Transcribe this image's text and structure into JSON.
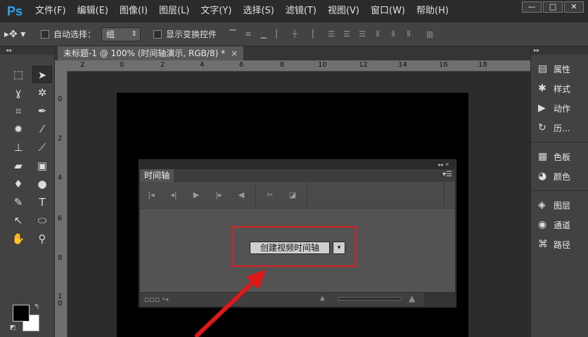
{
  "app": {
    "logo": "Ps"
  },
  "menu": [
    "文件(F)",
    "编辑(E)",
    "图像(I)",
    "图层(L)",
    "文字(Y)",
    "选择(S)",
    "滤镜(T)",
    "视图(V)",
    "窗口(W)",
    "帮助(H)"
  ],
  "window_controls": {
    "minimize": "—",
    "restore": "□",
    "close": "✕"
  },
  "options_bar": {
    "auto_select_label": "自动选择：",
    "auto_select_value": "组",
    "show_transform_label": "显示变换控件"
  },
  "document": {
    "tab_title": "未标题-1 @ 100% (时间轴演示, RGB/8) *",
    "close": "×"
  },
  "ruler": {
    "top_labels": [
      "2",
      "0",
      "2",
      "4",
      "6",
      "8",
      "10",
      "12",
      "14",
      "16",
      "18"
    ],
    "left_labels": [
      "0",
      "2",
      "4",
      "6",
      "8",
      "1 0"
    ]
  },
  "timeline": {
    "tab_label": "时间轴",
    "create_button_label": "创建视频时间轴",
    "dropdown_glyph": "▾"
  },
  "right_panel": {
    "groups": [
      [
        {
          "icon": "properties-icon",
          "label": "属性"
        },
        {
          "icon": "styles-icon",
          "label": "样式"
        },
        {
          "icon": "actions-icon",
          "label": "动作"
        },
        {
          "icon": "history-icon",
          "label": "历..."
        }
      ],
      [
        {
          "icon": "swatches-icon",
          "label": "色板"
        },
        {
          "icon": "color-icon",
          "label": "颜色"
        }
      ],
      [
        {
          "icon": "layers-icon",
          "label": "图层"
        },
        {
          "icon": "channels-icon",
          "label": "通道"
        },
        {
          "icon": "paths-icon",
          "label": "路径"
        }
      ]
    ]
  },
  "colors": {
    "highlight_red": "#e02020",
    "foreground": "#000000",
    "background": "#ffffff"
  }
}
